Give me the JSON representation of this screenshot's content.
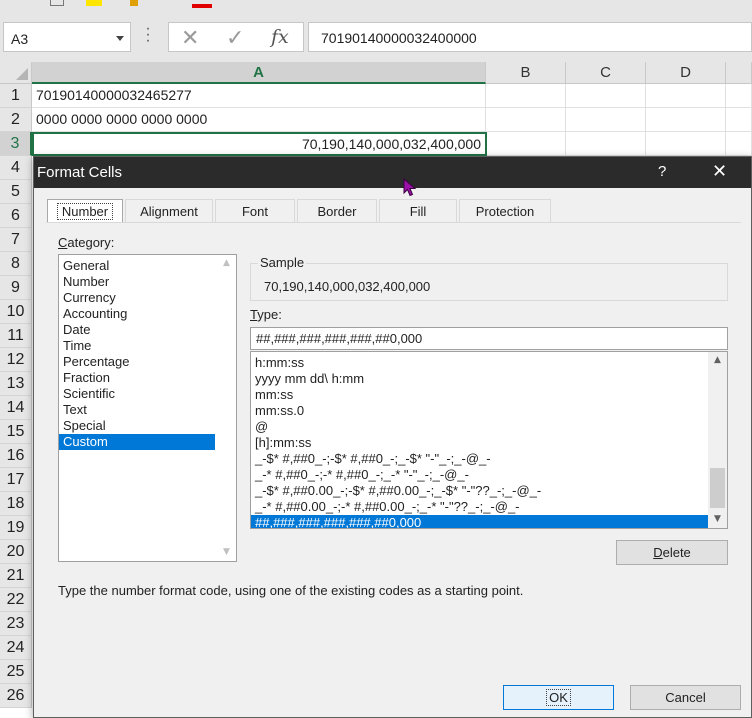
{
  "app": {
    "name_box": "A3",
    "formula_value": "70190140000032400000",
    "columns": [
      "A",
      "B",
      "C",
      "D"
    ],
    "rows": [
      "1",
      "2",
      "3",
      "4",
      "5",
      "6",
      "7",
      "8",
      "9",
      "10",
      "11",
      "12",
      "13",
      "14",
      "15",
      "16",
      "17",
      "18",
      "19",
      "20",
      "21",
      "22",
      "23",
      "24",
      "25",
      "26"
    ],
    "cells": {
      "A1": "70190140000032465277",
      "A2": "0000 0000 0000 0000 0000",
      "A3": "70,190,140,000,032,400,000"
    },
    "selected_cell": "A3",
    "accent_color": "#217346"
  },
  "icons": {
    "name_box_dropdown": "chevron-down-icon",
    "more": "more-dots-icon",
    "cancel": "cancel-x-icon",
    "enter": "check-icon",
    "insert_function": "fx-icon",
    "fx_label": "fx"
  },
  "dialog": {
    "title": "Format Cells",
    "help": "?",
    "tabs": [
      "Number",
      "Alignment",
      "Font",
      "Border",
      "Fill",
      "Protection"
    ],
    "active_tab": "Number",
    "category_label_prefix": "C",
    "category_label_rest": "ategory:",
    "categories": [
      "General",
      "Number",
      "Currency",
      "Accounting",
      "Date",
      "Time",
      "Percentage",
      "Fraction",
      "Scientific",
      "Text",
      "Special",
      "Custom"
    ],
    "selected_category": "Custom",
    "sample_label": "Sample",
    "sample_value": "70,190,140,000,032,400,000",
    "type_label_prefix": "T",
    "type_label_rest": "ype:",
    "type_value": "##,###,###,###,###,##0,000",
    "formats": [
      "h:mm:ss",
      "yyyy mm dd\\ h:mm",
      "mm:ss",
      "mm:ss.0",
      "@",
      "[h]:mm:ss",
      "_-$* #,##0_-;-$* #,##0_-;_-$* \"-\"_-;_-@_-",
      "_-* #,##0_-;-* #,##0_-;_-* \"-\"_-;_-@_-",
      "_-$* #,##0.00_-;-$* #,##0.00_-;_-$* \"-\"??_-;_-@_-",
      "_-* #,##0.00_-;-* #,##0.00_-;_-* \"-\"??_-;_-@_-",
      "##,###,###,###,###,##0,000"
    ],
    "selected_format_index": 10,
    "delete_prefix": "D",
    "delete_rest": "elete",
    "hint": "Type the number format code, using one of the existing codes as a starting point.",
    "ok_label": "OK",
    "cancel_label": "Cancel",
    "selection_color": "#0078d7"
  }
}
